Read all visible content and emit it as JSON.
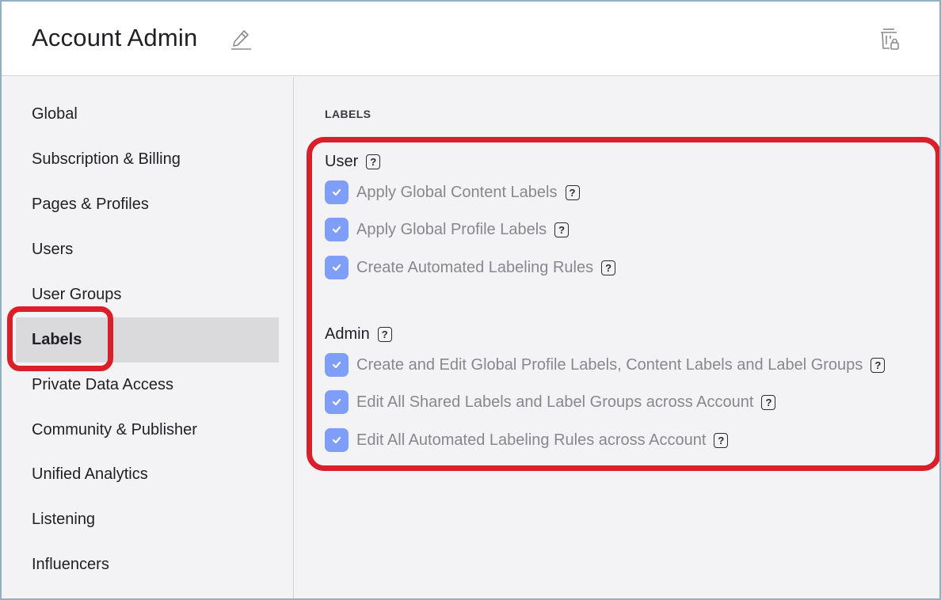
{
  "header": {
    "title": "Account Admin",
    "edit_icon": "pencil-icon",
    "delete_icon": "trash-lock-icon"
  },
  "sidebar": {
    "items": [
      {
        "label": "Global"
      },
      {
        "label": "Subscription & Billing"
      },
      {
        "label": "Pages & Profiles"
      },
      {
        "label": "Users"
      },
      {
        "label": "User Groups"
      },
      {
        "label": "Labels",
        "active": true
      },
      {
        "label": "Private Data Access"
      },
      {
        "label": "Community & Publisher"
      },
      {
        "label": "Unified Analytics"
      },
      {
        "label": "Listening"
      },
      {
        "label": "Influencers"
      }
    ]
  },
  "main": {
    "section_title": "LABELS",
    "help_glyph": "?",
    "groups": [
      {
        "label": "User",
        "permissions": [
          {
            "label": "Apply Global Content Labels",
            "checked": true
          },
          {
            "label": "Apply Global Profile Labels",
            "checked": true
          },
          {
            "label": "Create Automated Labeling Rules",
            "checked": true
          }
        ]
      },
      {
        "label": "Admin",
        "permissions": [
          {
            "label": "Create and Edit Global Profile Labels, Content Labels and Label Groups",
            "checked": true
          },
          {
            "label": "Edit All Shared Labels and Label Groups across Account",
            "checked": true
          },
          {
            "label": "Edit All Automated Labeling Rules across Account",
            "checked": true
          }
        ]
      }
    ]
  },
  "colors": {
    "accent_checkbox": "#7f9ef7",
    "highlight": "#d81f2a",
    "active_item_bg": "#dadadd"
  }
}
